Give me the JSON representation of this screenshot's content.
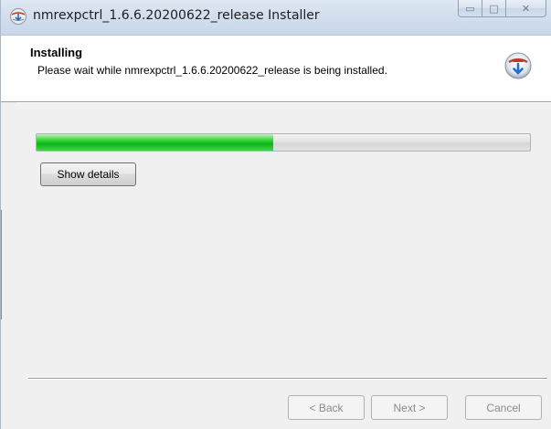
{
  "window": {
    "title": "nmrexpctrl_1.6.6.20200622_release Installer",
    "icon": "installer-globe-icon",
    "caption_buttons": {
      "minimize_glyph": "▭",
      "maximize_glyph": "□",
      "close_glyph": "✕"
    }
  },
  "header": {
    "title": "Installing",
    "subtitle": "Please wait while nmrexpctrl_1.6.6.20200622_release is being installed.",
    "icon": "install-disc-icon"
  },
  "progress": {
    "fraction": 0.48,
    "fill_color": "#16c41f"
  },
  "buttons": {
    "show_details": "Show details",
    "back": "< Back",
    "next": "Next >",
    "cancel": "Cancel"
  }
}
